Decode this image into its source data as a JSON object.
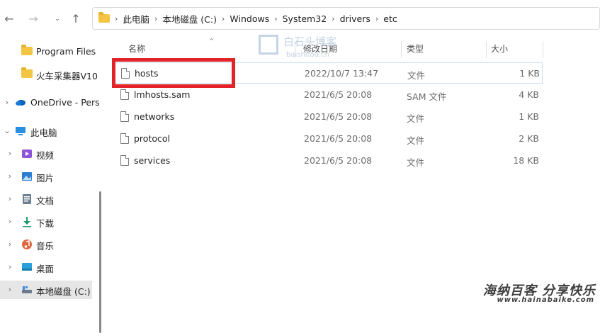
{
  "nav": {
    "back_icon": "back-arrow-icon",
    "forward_icon": "forward-arrow-icon",
    "up_icon": "up-arrow-icon"
  },
  "breadcrumb": [
    "此电脑",
    "本地磁盘 (C:)",
    "Windows",
    "System32",
    "drivers",
    "etc"
  ],
  "sidebar": {
    "items": [
      {
        "label": "Program Files",
        "icon": "folder-icon"
      },
      {
        "label": "火车采集器V10",
        "icon": "folder-icon"
      },
      {
        "label": "OneDrive - Pers",
        "icon": "cloud-icon"
      },
      {
        "label": "此电脑",
        "icon": "pc-icon"
      },
      {
        "label": "视频",
        "icon": "video-icon"
      },
      {
        "label": "图片",
        "icon": "pictures-icon"
      },
      {
        "label": "文档",
        "icon": "documents-icon"
      },
      {
        "label": "下载",
        "icon": "download-icon"
      },
      {
        "label": "音乐",
        "icon": "music-icon"
      },
      {
        "label": "桌面",
        "icon": "desktop-icon"
      },
      {
        "label": "本地磁盘 (C:)",
        "icon": "drive-icon"
      }
    ]
  },
  "columns": {
    "name": "名称",
    "modified": "修改日期",
    "type": "类型",
    "size": "大小"
  },
  "files": [
    {
      "name": "hosts",
      "modified": "2022/10/7 13:47",
      "type": "文件",
      "size": "1 KB"
    },
    {
      "name": "lmhosts.sam",
      "modified": "2021/6/5 20:08",
      "type": "SAM 文件",
      "size": "4 KB"
    },
    {
      "name": "networks",
      "modified": "2021/6/5 20:08",
      "type": "文件",
      "size": "1 KB"
    },
    {
      "name": "protocol",
      "modified": "2021/6/5 20:08",
      "type": "文件",
      "size": "2 KB"
    },
    {
      "name": "services",
      "modified": "2021/6/5 20:08",
      "type": "文件",
      "size": "18 KB"
    }
  ],
  "watermarks": {
    "top": "白石头博客",
    "top_sub": "baishitou.cn",
    "bottom": "海纳百客 分享快乐",
    "bottom_sub": "www.hainabaike.com"
  },
  "colors": {
    "highlight_box": "#e2242a",
    "selection_border": "#c9dff3",
    "folder": "#f4c542"
  }
}
